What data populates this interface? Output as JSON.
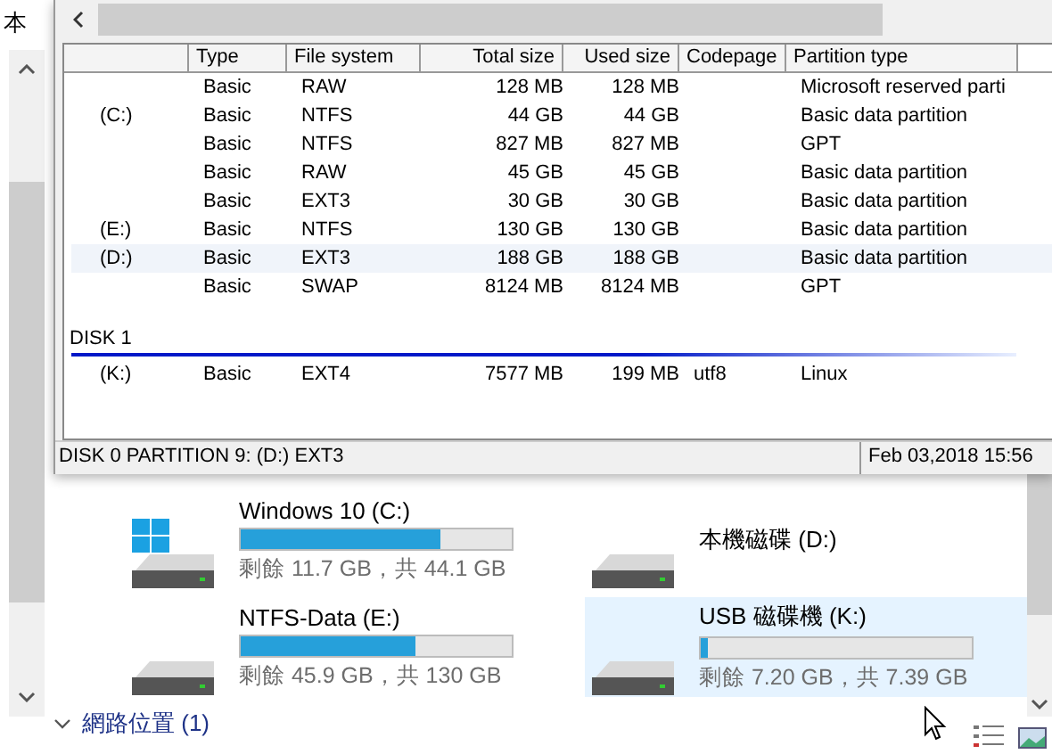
{
  "explorer": {
    "nav_label": "本",
    "drives": [
      {
        "name": "Windows 10 (C:)",
        "kind": "windows",
        "level": 0.735,
        "free": "剩餘 11.7 GB，共 44.1 GB",
        "selected": false
      },
      {
        "name": "本機磁碟 (D:)",
        "kind": "plain",
        "selected": false
      },
      {
        "name": "NTFS-Data (E:)",
        "kind": "plain",
        "level": 0.647,
        "free": "剩餘 45.9 GB，共 130 GB",
        "selected": false
      },
      {
        "name": "USB 磁碟機 (K:)",
        "kind": "plain",
        "level": 0.026,
        "free": "剩餘 7.20 GB，共 7.39 GB",
        "selected": true
      }
    ],
    "network_group": "網路位置 (1)"
  },
  "disk_window": {
    "columns": [
      "",
      "Type",
      "File system",
      "Total size",
      "Used size",
      "Codepage",
      "Partition type"
    ],
    "disks": [
      {
        "rows": [
          {
            "cells": [
              "",
              "Basic",
              "RAW",
              "128 MB",
              "128 MB",
              "",
              "Microsoft reserved parti"
            ],
            "selected": false
          },
          {
            "cells": [
              "(C:)",
              "Basic",
              "NTFS",
              "44 GB",
              "44 GB",
              "",
              "Basic data partition"
            ],
            "selected": false
          },
          {
            "cells": [
              "",
              "Basic",
              "NTFS",
              "827 MB",
              "827 MB",
              "",
              "GPT"
            ],
            "selected": false
          },
          {
            "cells": [
              "",
              "Basic",
              "RAW",
              "45 GB",
              "45 GB",
              "",
              "Basic data partition"
            ],
            "selected": false
          },
          {
            "cells": [
              "",
              "Basic",
              "EXT3",
              "30 GB",
              "30 GB",
              "",
              "Basic data partition"
            ],
            "selected": false
          },
          {
            "cells": [
              "(E:)",
              "Basic",
              "NTFS",
              "130 GB",
              "130 GB",
              "",
              "Basic data partition"
            ],
            "selected": false
          },
          {
            "cells": [
              "(D:)",
              "Basic",
              "EXT3",
              "188 GB",
              "188 GB",
              "",
              "Basic data partition"
            ],
            "selected": true
          },
          {
            "cells": [
              "",
              "Basic",
              "SWAP",
              "8124 MB",
              "8124 MB",
              "",
              "GPT"
            ],
            "selected": false
          }
        ]
      },
      {
        "label": "DISK 1",
        "rows": [
          {
            "cells": [
              "(K:)",
              "Basic",
              "EXT4",
              "7577 MB",
              "199 MB",
              "utf8",
              "Linux"
            ],
            "selected": false
          }
        ]
      }
    ],
    "status": "DISK 0 PARTITION 9: (D:) EXT3",
    "status_date": "Feb 03,2018 15:56"
  }
}
